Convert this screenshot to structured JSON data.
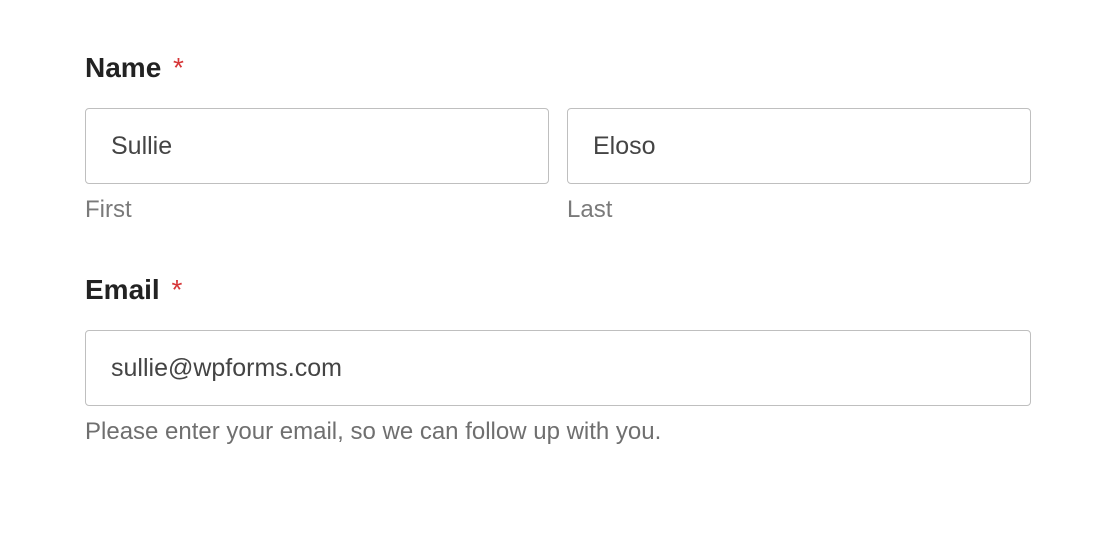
{
  "name": {
    "label": "Name",
    "required_marker": "*",
    "first": {
      "value": "Sullie",
      "sublabel": "First"
    },
    "last": {
      "value": "Eloso",
      "sublabel": "Last"
    }
  },
  "email": {
    "label": "Email",
    "required_marker": "*",
    "value": "sullie@wpforms.com",
    "description": "Please enter your email, so we can follow up with you."
  }
}
